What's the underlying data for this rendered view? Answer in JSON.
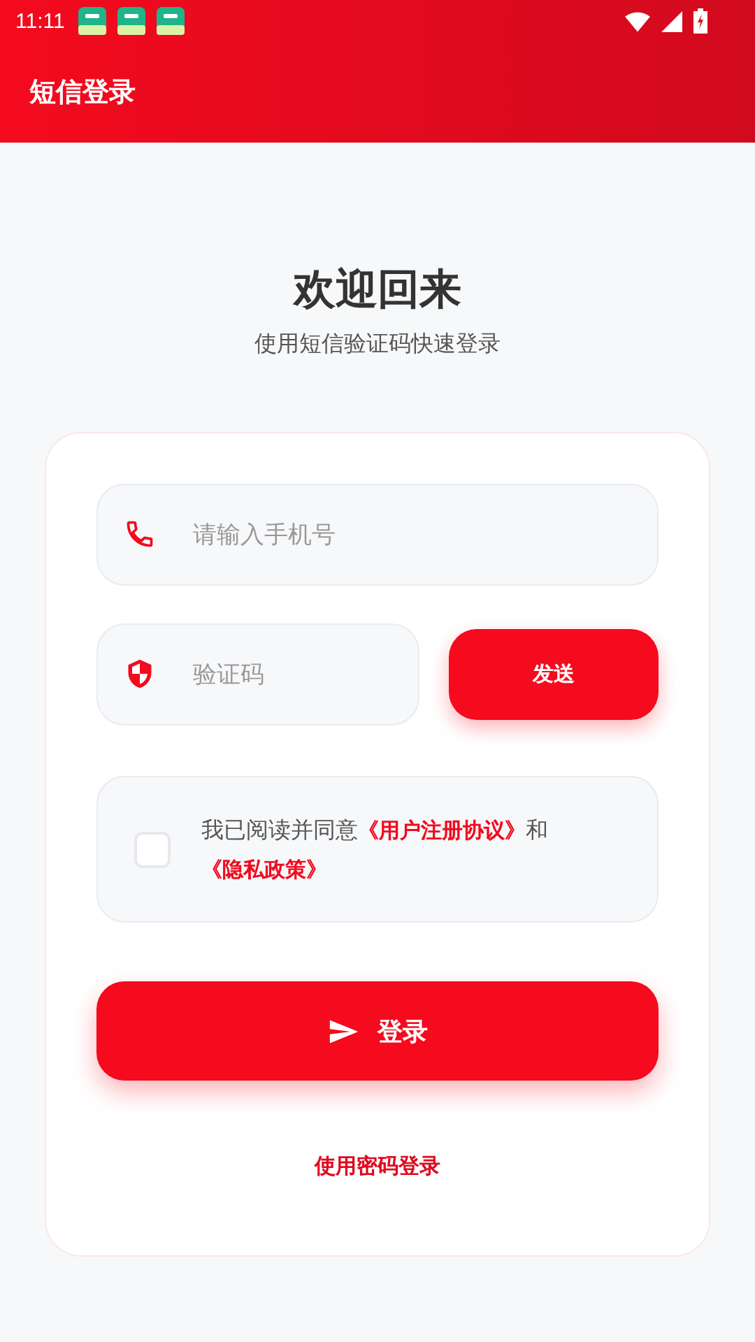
{
  "status_bar": {
    "time": "11:11",
    "notifications": [
      {
        "kind": "app"
      },
      {
        "kind": "app"
      },
      {
        "kind": "app"
      }
    ]
  },
  "header": {
    "title": "短信登录"
  },
  "welcome": {
    "title": "欢迎回来",
    "subtitle": "使用短信验证码快速登录"
  },
  "phone_field": {
    "placeholder": "请输入手机号"
  },
  "code_field": {
    "placeholder": "验证码"
  },
  "send_button": {
    "label": "发送"
  },
  "agreement": {
    "checked": false,
    "prefix": "我已阅读并同意",
    "terms_link": "《用户注册协议》",
    "conjunction": "和",
    "privacy_link": "《隐私政策》"
  },
  "login_button": {
    "label": "登录"
  },
  "password_login_link": {
    "label": "使用密码登录"
  }
}
